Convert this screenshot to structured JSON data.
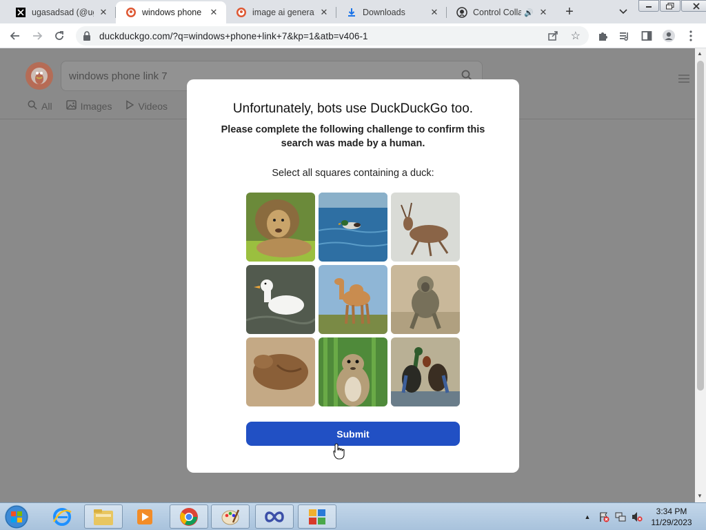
{
  "tabs": [
    {
      "title": "ugasadsad (@uga",
      "icon": "x-logo-icon"
    },
    {
      "title": "windows phone li",
      "icon": "duckduckgo-icon",
      "active": true
    },
    {
      "title": "image ai generato",
      "icon": "duckduckgo-icon"
    },
    {
      "title": "Downloads",
      "icon": "download-icon"
    },
    {
      "title": "Control Colla",
      "icon": "github-icon"
    }
  ],
  "omnibox": {
    "url": "duckduckgo.com/?q=windows+phone+link+7&kp=1&atb=v406-1"
  },
  "search": {
    "query": "windows phone link 7"
  },
  "search_tabs": [
    "All",
    "Images",
    "Videos"
  ],
  "modal": {
    "title": "Unfortunately, bots use DuckDuckGo too.",
    "subtitle": "Please complete the following challenge to confirm this search was made by a human.",
    "prompt": "Select all squares containing a duck:",
    "submit_label": "Submit",
    "grid": [
      {
        "animal": "lion"
      },
      {
        "animal": "duck-swimming"
      },
      {
        "animal": "deer"
      },
      {
        "animal": "white-duck"
      },
      {
        "animal": "camel"
      },
      {
        "animal": "baboon"
      },
      {
        "animal": "sleeping-dog"
      },
      {
        "animal": "squirrel"
      },
      {
        "animal": "ducks-pair"
      }
    ]
  },
  "clock": {
    "time": "3:34 PM",
    "date": "11/29/2023"
  },
  "colors": {
    "submit": "#2150c4",
    "overlay": "#8a8a8a"
  }
}
